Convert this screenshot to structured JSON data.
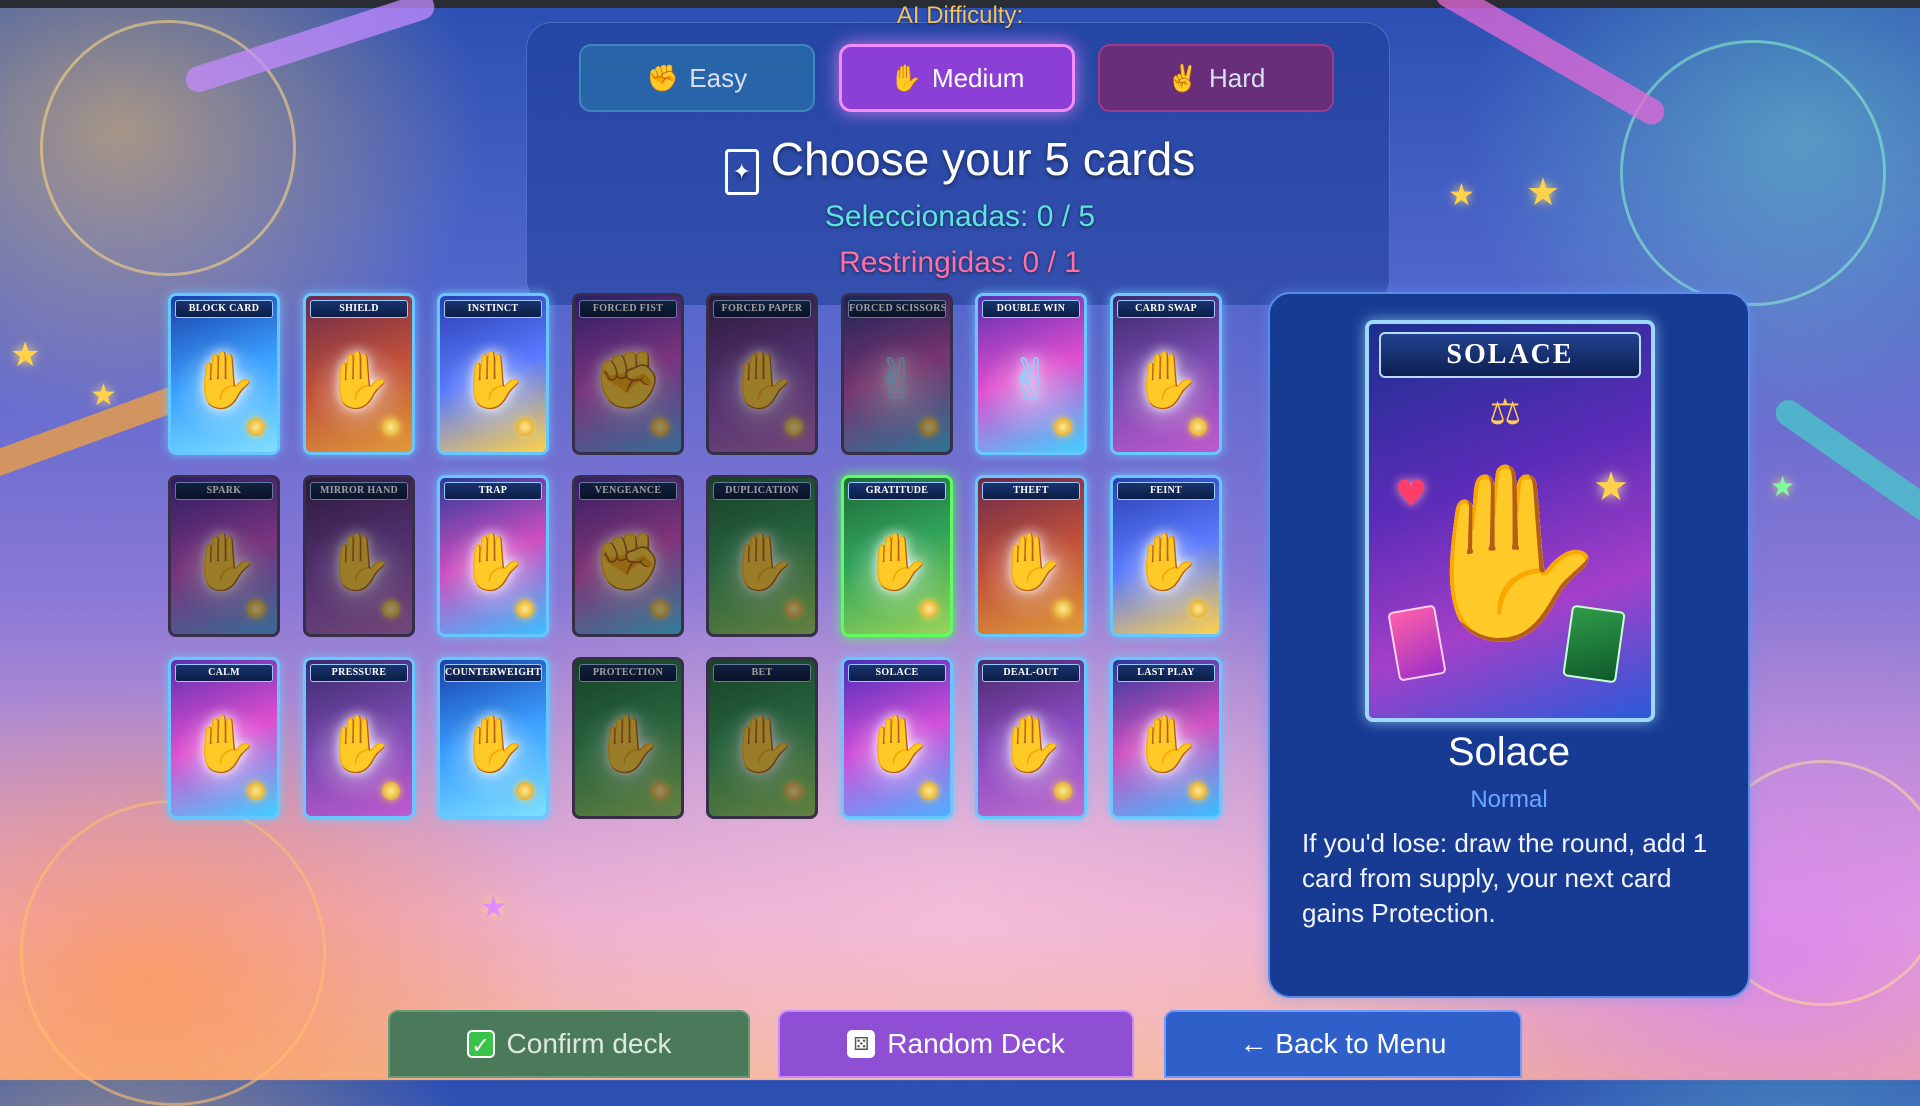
{
  "difficulty": {
    "label": "AI Difficulty:",
    "options": [
      {
        "label": "Easy",
        "icon": "fist-icon",
        "selected": false
      },
      {
        "label": "Medium",
        "icon": "palm-icon",
        "selected": true
      },
      {
        "label": "Hard",
        "icon": "victory-hand-icon",
        "selected": false
      }
    ]
  },
  "header": {
    "title": "Choose your 5 cards",
    "selected_text": "Seleccionadas: 0 / 5",
    "restricted_text": "Restringidas: 0 / 1"
  },
  "cards": [
    {
      "name": "BLOCK CARD",
      "state": "normal"
    },
    {
      "name": "SHIELD",
      "state": "normal"
    },
    {
      "name": "INSTINCT",
      "state": "normal"
    },
    {
      "name": "FORCED FIST",
      "state": "dim"
    },
    {
      "name": "FORCED PAPER",
      "state": "dim"
    },
    {
      "name": "FORCED SCISSORS",
      "state": "dim"
    },
    {
      "name": "DOUBLE WIN",
      "state": "normal"
    },
    {
      "name": "CARD SWAP",
      "state": "normal"
    },
    {
      "name": "SPARK",
      "state": "dim"
    },
    {
      "name": "MIRROR HAND",
      "state": "dim"
    },
    {
      "name": "TRAP",
      "state": "normal"
    },
    {
      "name": "VENGEANCE",
      "state": "dim"
    },
    {
      "name": "DUPLICATION",
      "state": "dim"
    },
    {
      "name": "GRATITUDE",
      "state": "highlight"
    },
    {
      "name": "THEFT",
      "state": "normal"
    },
    {
      "name": "FEINT",
      "state": "normal"
    },
    {
      "name": "CALM",
      "state": "normal"
    },
    {
      "name": "PRESSURE",
      "state": "normal"
    },
    {
      "name": "COUNTERWEIGHT",
      "state": "normal"
    },
    {
      "name": "PROTECTION",
      "state": "dim"
    },
    {
      "name": "BET",
      "state": "dim"
    },
    {
      "name": "SOLACE",
      "state": "normal"
    },
    {
      "name": "DEAL-OUT",
      "state": "normal"
    },
    {
      "name": "LAST PLAY",
      "state": "normal"
    }
  ],
  "detail": {
    "card_banner": "SOLACE",
    "name": "Solace",
    "type": "Normal",
    "description": "If you'd lose: draw the round, add 1 card from supply, your next card gains Protection."
  },
  "buttons": {
    "confirm": "Confirm deck",
    "random": "Random Deck",
    "back": "← Back to Menu"
  },
  "colors": {
    "selected_count": "#5fe3e0",
    "restricted_count": "#ff6fa5",
    "medium_accent": "#8b3fd6",
    "highlight_border": "#5cff5c"
  }
}
